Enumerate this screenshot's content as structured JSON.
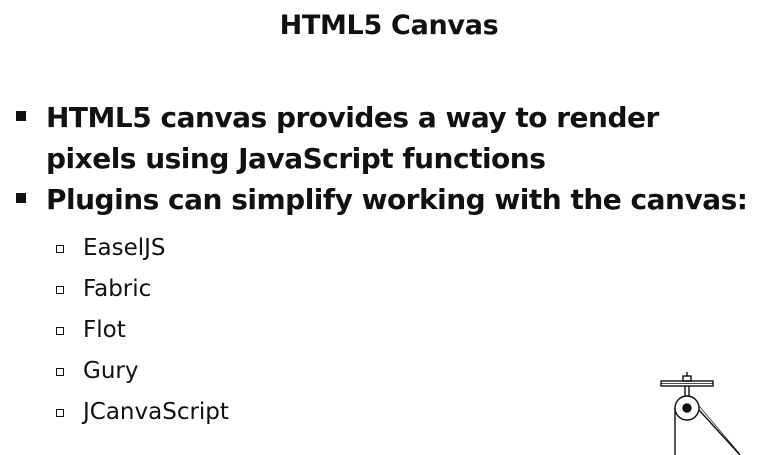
{
  "slide": {
    "title": "HTML5 Canvas",
    "bullets": [
      {
        "text": "HTML5 canvas provides a way to render pixels using JavaScript functions"
      },
      {
        "text": "Plugins can simplify working with the canvas:"
      }
    ],
    "sub_items": [
      {
        "text": "EaselJS"
      },
      {
        "text": "Fabric"
      },
      {
        "text": "Flot"
      },
      {
        "text": "Gury"
      },
      {
        "text": "JCanvaScript"
      }
    ],
    "decoration": {
      "icon": "pulley-icon"
    }
  }
}
